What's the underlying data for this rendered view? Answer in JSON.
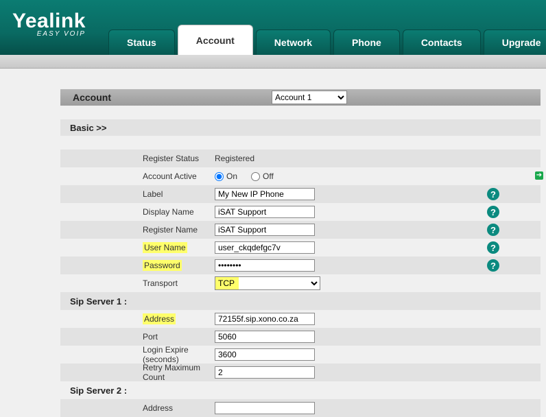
{
  "brand": {
    "name": "Yealink",
    "tagline": "EASY VOIP"
  },
  "tabs": [
    "Status",
    "Account",
    "Network",
    "Phone",
    "Contacts",
    "Upgrade"
  ],
  "activeTab": "Account",
  "accountSelector": {
    "label": "Account",
    "options": [
      "Account 1"
    ],
    "selected": "Account 1"
  },
  "sections": {
    "basic": {
      "title": "Basic >>",
      "registerStatus": {
        "label": "Register Status",
        "value": "Registered"
      },
      "accountActive": {
        "label": "Account Active",
        "options": {
          "on": "On",
          "off": "Off"
        },
        "selected": "on"
      },
      "labelField": {
        "label": "Label",
        "value": "My New IP Phone"
      },
      "displayName": {
        "label": "Display Name",
        "value": "iSAT Support"
      },
      "registerName": {
        "label": "Register Name",
        "value": "iSAT Support"
      },
      "userName": {
        "label": "User Name",
        "value": "user_ckqdefgc7v",
        "highlight": true
      },
      "password": {
        "label": "Password",
        "value": "••••••••",
        "highlight": true
      },
      "transport": {
        "label": "Transport",
        "options": [
          "TCP"
        ],
        "selected": "TCP",
        "highlight": true
      }
    },
    "sipServer1": {
      "title": "Sip Server 1 :",
      "address": {
        "label": "Address",
        "value": "72155f.sip.xono.co.za",
        "highlight": true
      },
      "port": {
        "label": "Port",
        "value": "5060"
      },
      "loginExpire": {
        "label": "Login Expire (seconds)",
        "value": "3600"
      },
      "retryMax": {
        "label": "Retry Maximum Count",
        "value": "2"
      }
    },
    "sipServer2": {
      "title": "Sip Server 2 :",
      "address": {
        "label": "Address",
        "value": ""
      }
    }
  }
}
